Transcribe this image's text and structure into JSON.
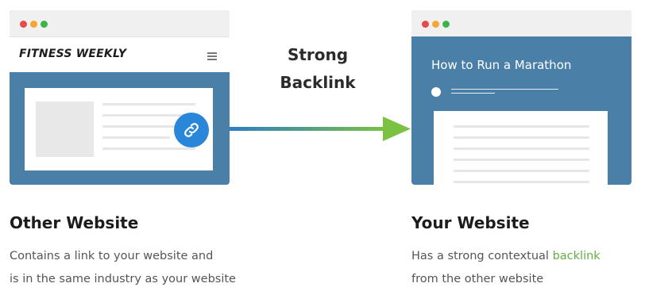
{
  "left_site": {
    "name": "FITNESS WEEKLY",
    "caption_title": "Other Website",
    "caption_lines": [
      "Contains a link to your website and",
      "is in the same industry as your website"
    ]
  },
  "arrow": {
    "label_line1": "Strong",
    "label_line2": "Backlink"
  },
  "right_site": {
    "post_title": "How to Run a Marathon",
    "caption_title": "Your Website",
    "caption_prefix": "Has a strong contextual ",
    "caption_highlight": "backlink",
    "caption_line2": "from the other website"
  },
  "icons": [
    "window-controls",
    "hamburger-menu-icon",
    "link-icon",
    "arrow-right"
  ],
  "colors": {
    "browser_body": "#4a7fa8",
    "link_badge": "#2a86d8",
    "arrow_start": "#2f7ec4",
    "arrow_end": "#7cc242",
    "highlight": "#5fb043"
  }
}
